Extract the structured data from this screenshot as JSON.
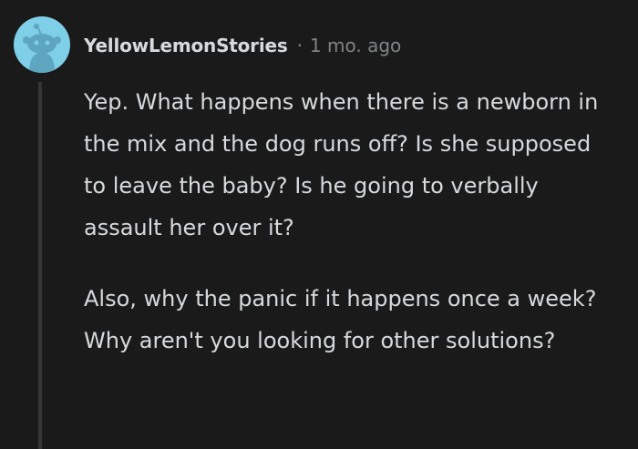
{
  "comment": {
    "author": "YellowLemonStories",
    "separator": "·",
    "timestamp": "1 mo. ago",
    "avatar_icon": "snoo-avatar-icon",
    "avatar_color": "#7fcfe8",
    "paragraphs": [
      "Yep. What happens when there is a newborn in the mix and the dog runs off? Is she supposed to leave the baby? Is he going to verbally assault her over it?",
      "Also, why the panic if it happens once a week? Why aren't you looking for other solutions?"
    ]
  },
  "colors": {
    "background": "#1a1a1b",
    "text": "#d7dadc",
    "meta": "#818384",
    "thread_line": "#343536"
  }
}
